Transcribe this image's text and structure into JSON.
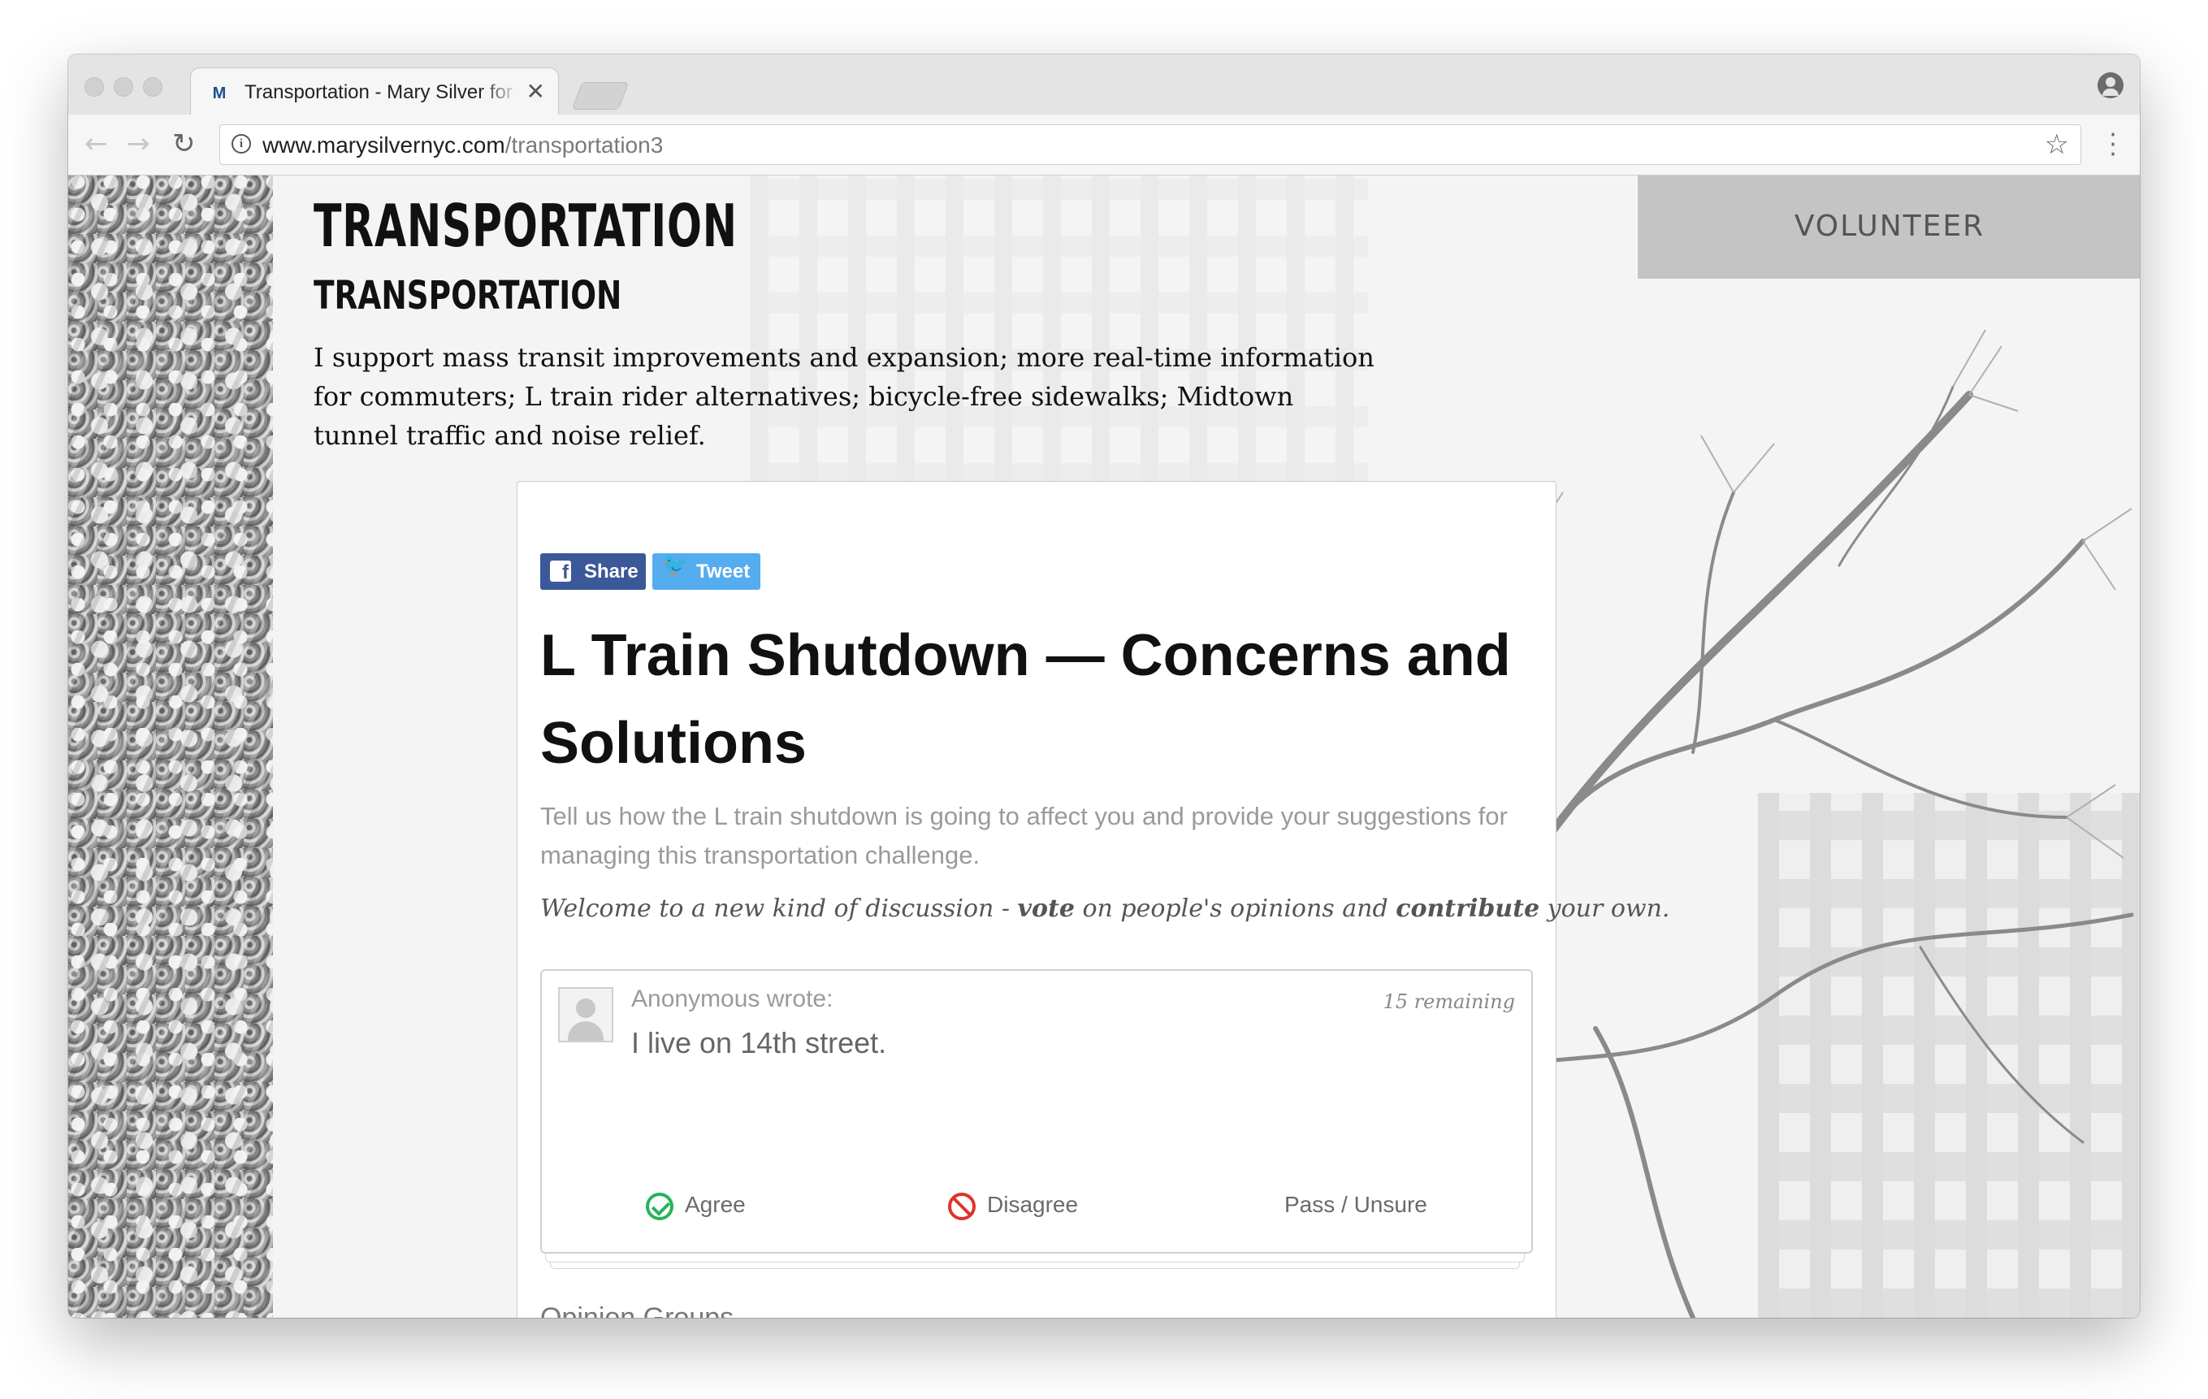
{
  "browser": {
    "tab_title": "Transportation - Mary Silver for",
    "tab_favicon": "M",
    "close_glyph": "✕",
    "url_domain": "www.marysilvernyc.com",
    "url_path": "/transportation3",
    "back_glyph": "←",
    "forward_glyph": "→",
    "reload_glyph": "↻",
    "star_glyph": "☆",
    "menu_glyph": "⋮"
  },
  "page": {
    "heading": "TRANSPORTATION",
    "subheading": "TRANSPORTATION",
    "intro": "I support mass transit improvements and expansion; more real-time information for commuters; L train rider alternatives; bicycle-free sidewalks; Midtown tunnel traffic and noise relief.",
    "volunteer_label": "VOLUNTEER"
  },
  "discussion": {
    "share_label": "Share",
    "share_icon": "f",
    "tweet_label": "Tweet",
    "tweet_icon": "🐦",
    "title": "L Train Shutdown — Concerns and Solutions",
    "description": "Tell us how the L train shutdown is going to affect you and provide your suggestions for managing this transportation challenge.",
    "welcome_1": "Welcome to a new kind of discussion - ",
    "welcome_vote": "vote",
    "welcome_2": " on people's opinions and ",
    "welcome_contribute": "contribute",
    "welcome_3": " your own.",
    "comment": {
      "author": "Anonymous wrote:",
      "remaining": "15 remaining",
      "text": "I live on 14th street.",
      "agree": "Agree",
      "disagree": "Disagree",
      "pass": "Pass / Unsure"
    },
    "opinion_groups": "Opinion Groups"
  },
  "colors": {
    "facebook": "#3b5998",
    "twitter": "#55acee",
    "agree": "#27b35a",
    "disagree": "#e0332a",
    "volunteer_bg": "#c4c4c4"
  }
}
